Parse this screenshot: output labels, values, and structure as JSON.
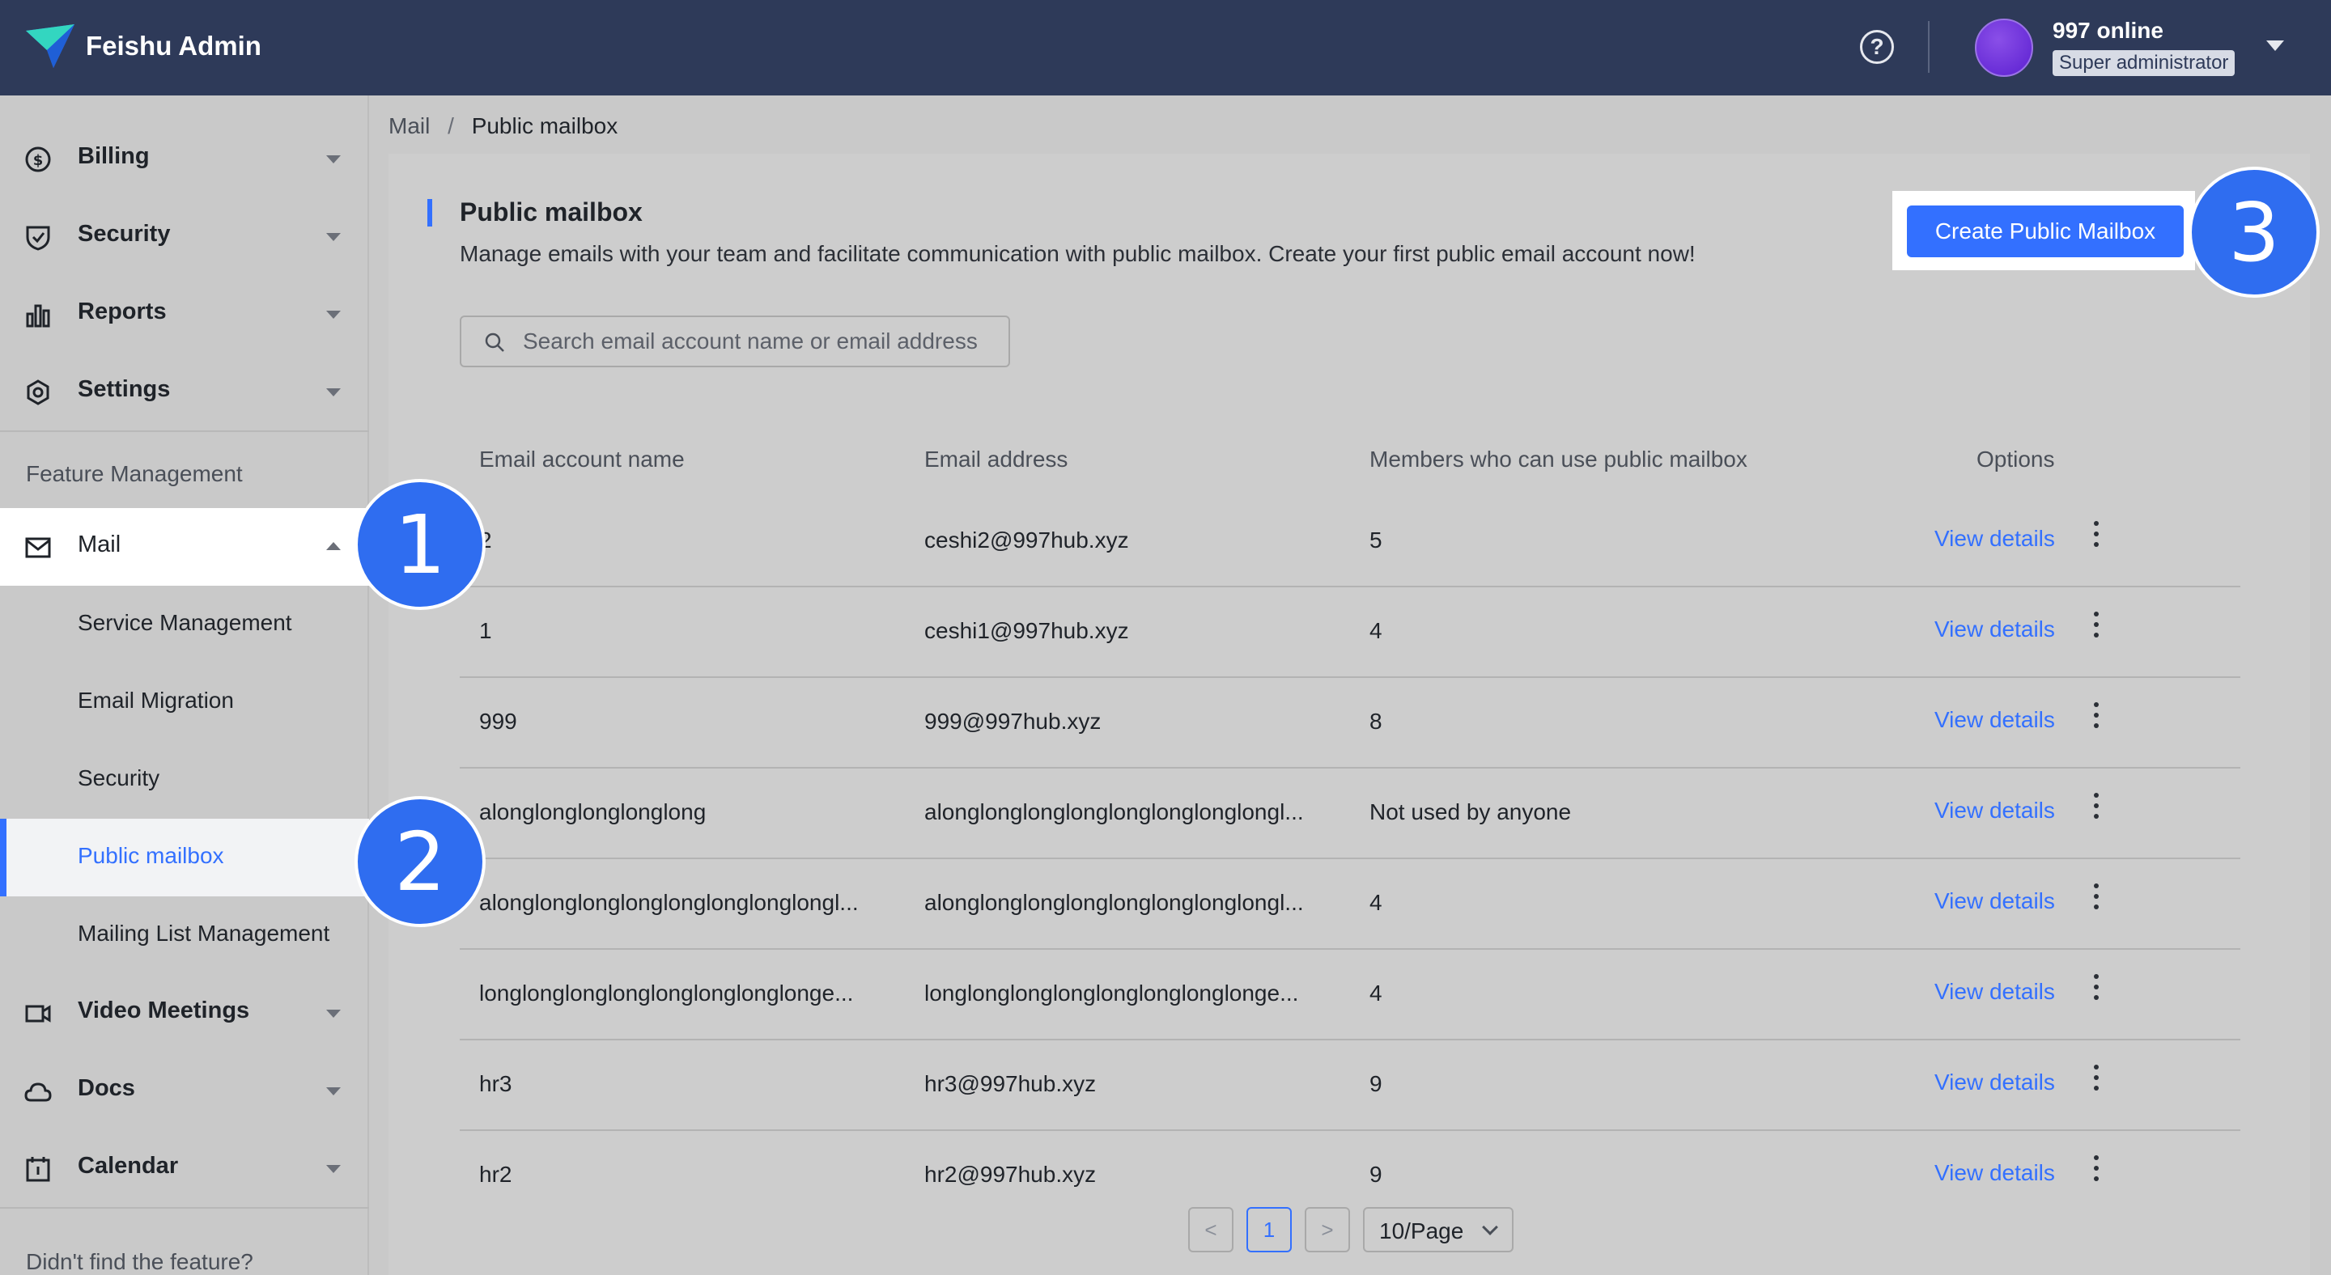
{
  "header": {
    "brand": "Feishu Admin",
    "help_icon": "question-icon",
    "user_name": "997 online",
    "user_role": "Super administrator"
  },
  "sidebar": {
    "billing": "Billing",
    "security": "Security",
    "reports": "Reports",
    "settings": "Settings",
    "feature_management": "Feature Management",
    "mail": "Mail",
    "mail_sub": {
      "service": "Service Management",
      "migration": "Email Migration",
      "security": "Security",
      "public": "Public mailbox",
      "mailing": "Mailing List Management"
    },
    "video": "Video Meetings",
    "docs": "Docs",
    "calendar": "Calendar",
    "footer": "Didn't find the feature?"
  },
  "breadcrumb": {
    "parent": "Mail",
    "separator": "/",
    "current": "Public mailbox"
  },
  "main": {
    "title": "Public mailbox",
    "description": "Manage emails with your team and facilitate communication with public mailbox. Create your first public email account now!",
    "create_button": "Create Public Mailbox",
    "search_placeholder": "Search email account name or email address"
  },
  "table": {
    "headers": {
      "name": "Email account name",
      "address": "Email address",
      "members": "Members who can use public mailbox",
      "options": "Options"
    },
    "view_label": "View details",
    "rows": [
      {
        "name": "2",
        "address": "ceshi2@997hub.xyz",
        "members": "5"
      },
      {
        "name": "1",
        "address": "ceshi1@997hub.xyz",
        "members": "4"
      },
      {
        "name": "999",
        "address": "999@997hub.xyz",
        "members": "8"
      },
      {
        "name": "alonglonglonglonglong",
        "address": "alonglonglonglonglonglonglonglongl...",
        "members": "Not used by anyone"
      },
      {
        "name": "alonglonglonglonglonglonglonglongl...",
        "address": "alonglonglonglonglonglonglonglongl...",
        "members": "4"
      },
      {
        "name": "longlonglonglonglonglonglonglonge...",
        "address": "longlonglonglonglonglonglonglonge...",
        "members": "4"
      },
      {
        "name": "hr3",
        "address": "hr3@997hub.xyz",
        "members": "9"
      },
      {
        "name": "hr2",
        "address": "hr2@997hub.xyz",
        "members": "9"
      }
    ]
  },
  "pagination": {
    "prev": "<",
    "page": "1",
    "next": ">",
    "page_size": "10/Page"
  },
  "markers": {
    "m1": "1",
    "m2": "2",
    "m3": "3"
  },
  "colors": {
    "topbar": "#2e3a59",
    "accent": "#3370ff",
    "marker": "#2f6df0"
  }
}
